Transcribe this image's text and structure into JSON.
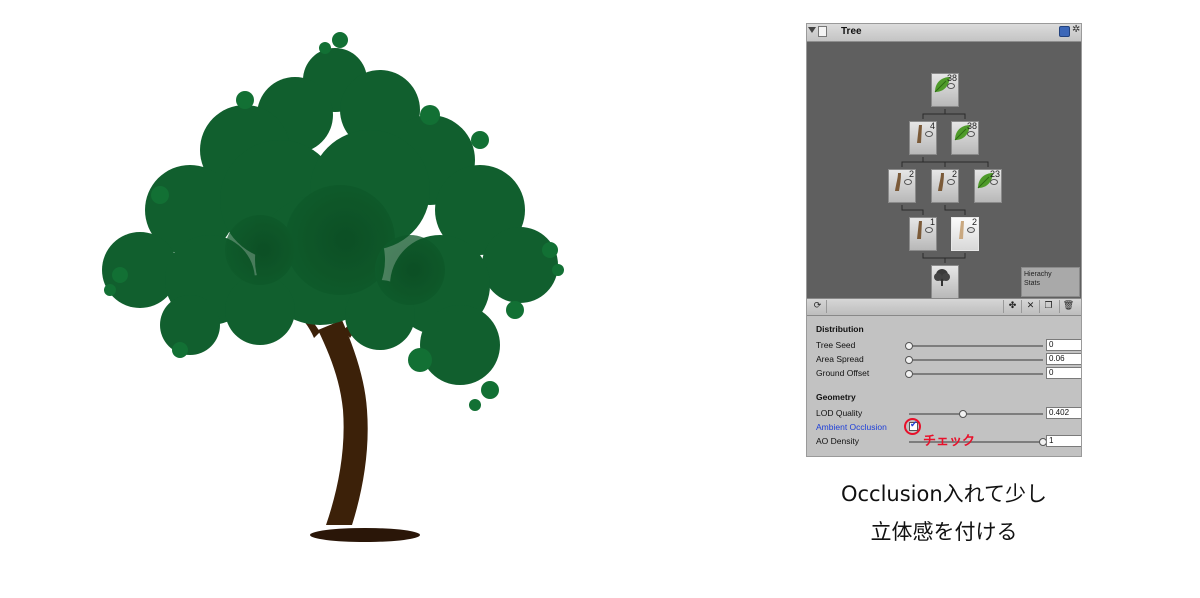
{
  "inspector": {
    "title": "Tree",
    "nodes": [
      {
        "id": "leaf-top",
        "kind": "leaf",
        "count": "38"
      },
      {
        "id": "branch-l",
        "kind": "branch",
        "count": "4"
      },
      {
        "id": "leaf-r",
        "kind": "leaf",
        "count": "38"
      },
      {
        "id": "branch-a",
        "kind": "branch",
        "count": "2"
      },
      {
        "id": "branch-b",
        "kind": "branch",
        "count": "2"
      },
      {
        "id": "leaf-c",
        "kind": "leaf",
        "count": "23"
      },
      {
        "id": "branch-d",
        "kind": "branch",
        "count": "1"
      },
      {
        "id": "branch-e",
        "kind": "branch",
        "count": "2"
      },
      {
        "id": "root",
        "kind": "root",
        "count": ""
      }
    ],
    "stats": {
      "line1": "Hierachy",
      "line2": "Stats"
    },
    "toolbar_icons": [
      "refresh-icon",
      "add-leaf-group-icon",
      "add-branch-group-icon",
      "duplicate-icon",
      "delete-icon"
    ],
    "distribution": {
      "title": "Distribution",
      "tree_seed": {
        "label": "Tree Seed",
        "value": "0",
        "fraction": 0
      },
      "area_spread": {
        "label": "Area Spread",
        "value": "0.06",
        "fraction": 0
      },
      "ground_offset": {
        "label": "Ground Offset",
        "value": "0",
        "fraction": 0
      }
    },
    "geometry": {
      "title": "Geometry",
      "lod_quality": {
        "label": "LOD Quality",
        "value": "0.402",
        "fraction": 0.402
      },
      "ambient_occlusion": {
        "label": "Ambient Occlusion",
        "checked": true
      },
      "ao_density": {
        "label": "AO Density",
        "value": "1",
        "fraction": 1
      }
    },
    "annotation": "チェック",
    "accent_red": "#e8102a",
    "highlight_blue": "#1e3fd8"
  },
  "caption": {
    "line1": "Occlusion入れて少し",
    "line2": "立体感を付ける"
  }
}
